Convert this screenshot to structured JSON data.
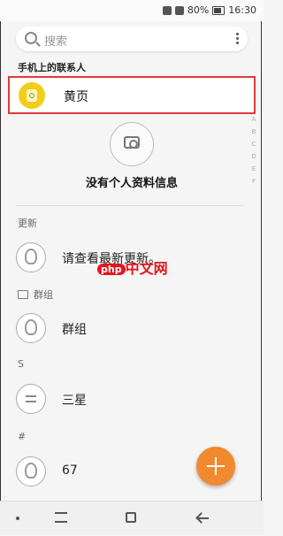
{
  "status": {
    "battery": "80%",
    "time": "16:30"
  },
  "search": {
    "placeholder": "搜索"
  },
  "sections": {
    "phone_contacts": "手机上的联系人",
    "updates": "更新",
    "groups": "群组",
    "s": "S",
    "hash": "#"
  },
  "yellow_pages": {
    "label": "黄页"
  },
  "profile": {
    "empty_text": "没有个人资料信息"
  },
  "rows": {
    "updates": "请查看最新更新。",
    "group": "群组",
    "samsung": "三星",
    "contact67": "67"
  },
  "index_letters": [
    "A",
    "B",
    "C",
    "D",
    "E",
    "F"
  ],
  "watermark": {
    "php": "php",
    "text": "中文网"
  },
  "colors": {
    "accent": "#f08a2c",
    "highlight_border": "#e03a3a",
    "yellow": "#f2cd1a"
  }
}
